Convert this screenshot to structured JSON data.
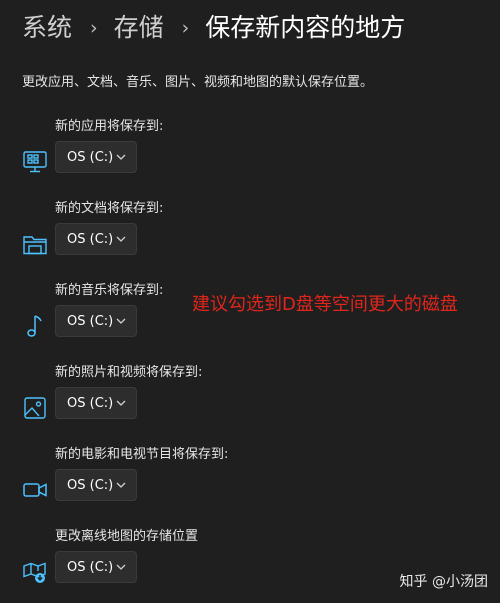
{
  "breadcrumb": {
    "items": [
      "系统",
      "存储",
      "保存新内容的地方"
    ],
    "separator": "›"
  },
  "description": "更改应用、文档、音乐、图片、视频和地图的默认保存位置。",
  "sections": [
    {
      "label": "新的应用将保存到:",
      "icon": "apps-icon",
      "value": "OS (C:)"
    },
    {
      "label": "新的文档将保存到:",
      "icon": "folder-icon",
      "value": "OS (C:)"
    },
    {
      "label": "新的音乐将保存到:",
      "icon": "music-note-icon",
      "value": "OS (C:)"
    },
    {
      "label": "新的照片和视频将保存到:",
      "icon": "image-icon",
      "value": "OS (C:)"
    },
    {
      "label": "新的电影和电视节目将保存到:",
      "icon": "video-camera-icon",
      "value": "OS (C:)"
    },
    {
      "label": "更改离线地图的存储位置",
      "icon": "offline-map-icon",
      "value": "OS (C:)"
    }
  ],
  "annotation": "建议勾选到D盘等空间更大的磁盘",
  "watermark": "知乎 @小汤团",
  "colors": {
    "background": "#1f1f1f",
    "accent_icon": "#4cc2ff",
    "annotation": "#e0251b",
    "dropdown_bg": "#2d2d2d"
  }
}
